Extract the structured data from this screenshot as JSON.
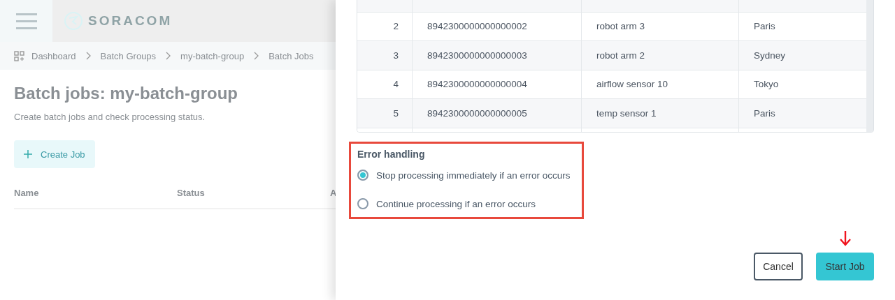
{
  "header": {
    "logo_text": "SORACOM"
  },
  "breadcrumb": [
    "Dashboard",
    "Batch Groups",
    "my-batch-group",
    "Batch Jobs"
  ],
  "page": {
    "title": "Batch jobs: my-batch-group",
    "subtitle": "Create batch jobs and check processing status.",
    "create_button": "Create Job",
    "columns": [
      "Name",
      "Status",
      "A"
    ]
  },
  "drawer": {
    "table": {
      "rows": [
        {
          "index": "2",
          "iccid": "8942300000000000002",
          "name": "robot arm 3",
          "location": "Paris"
        },
        {
          "index": "3",
          "iccid": "8942300000000000003",
          "name": "robot arm 2",
          "location": "Sydney"
        },
        {
          "index": "4",
          "iccid": "8942300000000000004",
          "name": "airflow sensor 10",
          "location": "Tokyo"
        },
        {
          "index": "5",
          "iccid": "8942300000000000005",
          "name": "temp sensor 1",
          "location": "Paris"
        }
      ]
    },
    "error_handling": {
      "title": "Error handling",
      "options": [
        {
          "label": "Stop processing immediately if an error occurs",
          "selected": true
        },
        {
          "label": "Continue processing if an error occurs",
          "selected": false
        }
      ]
    },
    "buttons": [
      {
        "label": "Cancel",
        "kind": "secondary"
      },
      {
        "label": "Start Job",
        "kind": "primary"
      }
    ]
  }
}
